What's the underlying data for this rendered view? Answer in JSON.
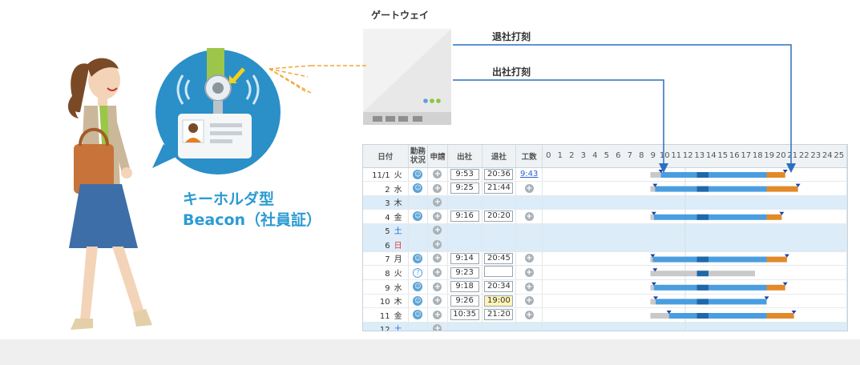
{
  "gateway": {
    "title": "ゲートウェイ"
  },
  "connections": {
    "checkout_label": "退社打刻",
    "checkin_label": "出社打刻"
  },
  "beacon": {
    "line1": "キーホルダ型",
    "line2": "Beacon（社員証）"
  },
  "colors": {
    "accent": "#2b9bd3",
    "bar_blue": "#4a9ee0",
    "bar_dark": "#1f68a8",
    "bar_orange": "#e28a2a",
    "bar_gray": "#c9c9c9",
    "arrow": "#2a6fc2"
  },
  "table": {
    "headers": {
      "date": "日付",
      "status": "勤務\n状況",
      "request": "申請",
      "in": "出社",
      "out": "退社",
      "hours": "工数"
    },
    "hour_ticks": [
      "0",
      "1",
      "2",
      "3",
      "4",
      "5",
      "6",
      "7",
      "8",
      "9",
      "10",
      "11",
      "12",
      "13",
      "14",
      "15",
      "16",
      "17",
      "18",
      "19",
      "20",
      "21",
      "22",
      "23",
      "24",
      "25"
    ],
    "rows": [
      {
        "date": "11/1",
        "day": "火",
        "kind": "work",
        "status": "smile",
        "in": "9:53",
        "out": "20:36",
        "hours": "9:43",
        "bar": [
          9.9,
          20.6
        ],
        "gray": [
          9.0,
          9.9
        ],
        "out_highlight": false
      },
      {
        "date": "2",
        "day": "水",
        "kind": "work",
        "status": "smile",
        "in": "9:25",
        "out": "21:44",
        "hours": "",
        "bar": [
          9.4,
          21.7
        ],
        "gray": [
          9.0,
          9.4
        ],
        "out_highlight": false
      },
      {
        "date": "3",
        "day": "木",
        "kind": "holiday",
        "status": "",
        "in": "",
        "out": "",
        "hours": ""
      },
      {
        "date": "4",
        "day": "金",
        "kind": "work",
        "status": "smile",
        "in": "9:16",
        "out": "20:20",
        "hours": "",
        "bar": [
          9.3,
          20.3
        ],
        "gray": [
          9.0,
          9.3
        ],
        "out_highlight": false
      },
      {
        "date": "5",
        "day": "土",
        "kind": "holiday",
        "status": "",
        "in": "",
        "out": "",
        "hours": ""
      },
      {
        "date": "6",
        "day": "日",
        "kind": "holiday",
        "status": "",
        "in": "",
        "out": "",
        "hours": ""
      },
      {
        "date": "7",
        "day": "月",
        "kind": "work",
        "status": "smile",
        "in": "9:14",
        "out": "20:45",
        "hours": "",
        "bar": [
          9.2,
          20.75
        ],
        "gray": [
          9.0,
          9.2
        ],
        "out_highlight": false
      },
      {
        "date": "8",
        "day": "火",
        "kind": "work",
        "status": "quest",
        "in": "9:23",
        "out": "",
        "hours": "",
        "bar": [
          9.4,
          9.4
        ],
        "gray": [
          9.0,
          18.0
        ],
        "out_highlight": false
      },
      {
        "date": "9",
        "day": "水",
        "kind": "work",
        "status": "smile",
        "in": "9:18",
        "out": "20:34",
        "hours": "",
        "bar": [
          9.3,
          20.6
        ],
        "gray": [
          9.0,
          9.3
        ],
        "out_highlight": false
      },
      {
        "date": "10",
        "day": "木",
        "kind": "work",
        "status": "smile",
        "in": "9:26",
        "out": "19:00",
        "hours": "",
        "bar": [
          9.45,
          19.0
        ],
        "gray": [
          9.0,
          9.45
        ],
        "out_highlight": true
      },
      {
        "date": "11",
        "day": "金",
        "kind": "work",
        "status": "smile",
        "in": "10:35",
        "out": "21:20",
        "hours": "",
        "bar": [
          10.6,
          21.35
        ],
        "gray": [
          9.0,
          10.6
        ],
        "out_highlight": false
      },
      {
        "date": "12",
        "day": "土",
        "kind": "holiday",
        "status": "",
        "in": "",
        "out": "",
        "hours": ""
      }
    ]
  }
}
